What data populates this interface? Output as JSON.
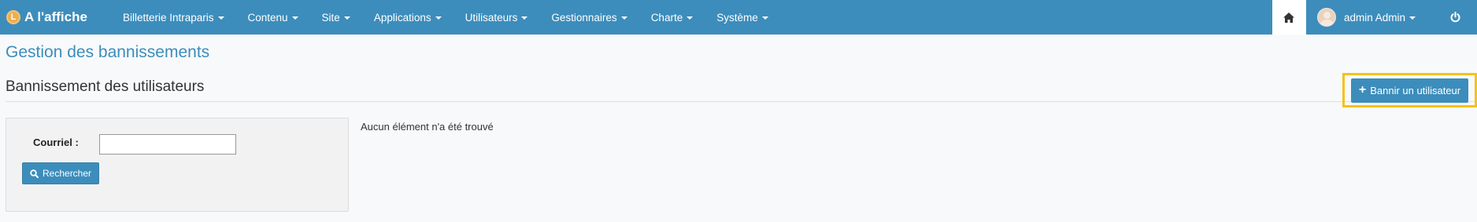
{
  "brand": {
    "logo_glyph": "L",
    "title": "A l'affiche"
  },
  "nav": {
    "items": [
      {
        "label": "Billetterie Intraparis"
      },
      {
        "label": "Contenu"
      },
      {
        "label": "Site"
      },
      {
        "label": "Applications"
      },
      {
        "label": "Utilisateurs"
      },
      {
        "label": "Gestionnaires"
      },
      {
        "label": "Charte"
      },
      {
        "label": "Système"
      }
    ],
    "user_label": "admin Admin",
    "home_icon": "home-icon",
    "power_icon": "power-icon"
  },
  "page": {
    "title": "Gestion des bannissements",
    "section_title": "Bannissement des utilisateurs",
    "ban_button_label": "Bannir un utilisateur"
  },
  "search": {
    "email_label": "Courriel :",
    "email_value": "",
    "search_button_label": "Rechercher"
  },
  "results": {
    "empty_message": "Aucun élément n'a été trouvé"
  },
  "colors": {
    "accent": "#3c8dbc",
    "highlight": "#f5c11b"
  }
}
